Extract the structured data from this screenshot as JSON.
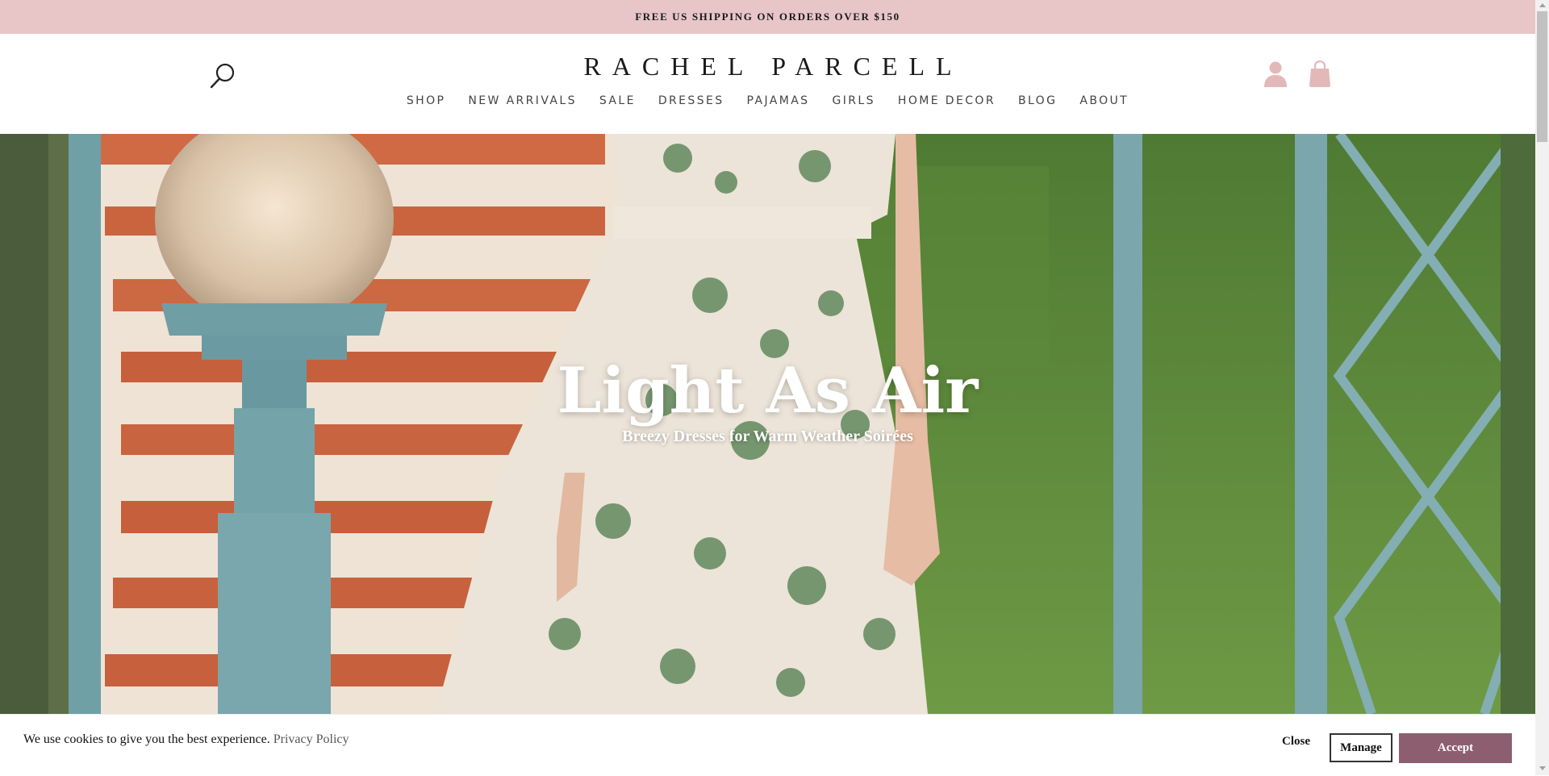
{
  "announcement": {
    "text": "FREE US SHIPPING ON ORDERS OVER $150"
  },
  "header": {
    "logo": "RACHEL PARCELL",
    "nav": [
      "SHOP",
      "NEW ARRIVALS",
      "SALE",
      "DRESSES",
      "PAJAMAS",
      "GIRLS",
      "HOME DECOR",
      "BLOG",
      "ABOUT"
    ],
    "icons": {
      "search": "search-icon",
      "account": "user-icon",
      "cart": "shopping-bag-icon"
    },
    "icon_color": "#e3b8b9"
  },
  "hero": {
    "title": "Light As Air",
    "subtitle": "Breezy Dresses for Warm Weather Soirées"
  },
  "cookie_banner": {
    "text": "We use cookies to give you the best experience.",
    "link": "Privacy Policy",
    "close_label": "Close",
    "manage_label": "Manage",
    "accept_label": "Accept",
    "accept_color": "#8d5e6f"
  },
  "colors": {
    "announcement_bg": "#e8c6c7",
    "brand": "#1a1a1a"
  }
}
